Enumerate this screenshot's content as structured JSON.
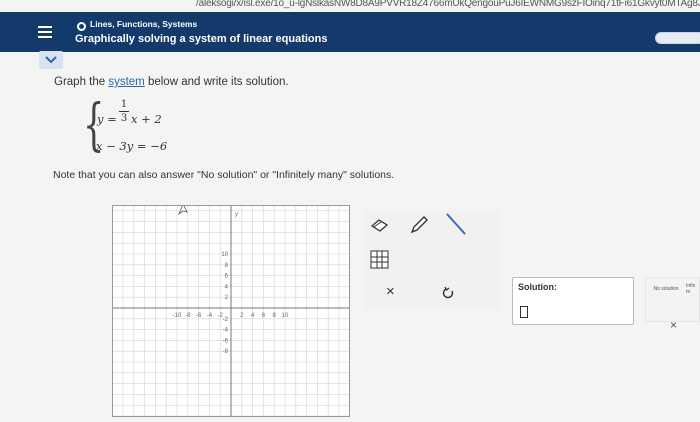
{
  "browser": {
    "url_fragment": "/aleksogi/x/isl.exe/1o_u-lgNslkasNW8D8A9PVVR18Z4766mUkQengouPuJ6IEWNMG9szFIOinq71tFi61Gkvyt0MTAg8JGUQ5c"
  },
  "header": {
    "breadcrumb": "Lines, Functions, Systems",
    "title": "Graphically solving a system of linear equations"
  },
  "question": {
    "prompt_before_link": "Graph the ",
    "prompt_link": "system",
    "prompt_after_link": " below and write its solution.",
    "eq1_lhs": "y = ",
    "eq1_numerator": "1",
    "eq1_denominator": "3",
    "eq1_rhs": "x + 2",
    "eq2": "x − 3y = −6",
    "note": "Note that you can also answer \"No solution\" or \"Infinitely many\" solutions."
  },
  "graph": {
    "x_ticks": [
      "-10",
      "-8",
      "-6",
      "-4",
      "-2",
      "2",
      "4",
      "6",
      "8",
      "10"
    ],
    "y_ticks": [
      "10",
      "8",
      "6",
      "4",
      "2",
      "-2",
      "-4",
      "-6",
      "-8"
    ],
    "xmin": -10,
    "xmax": 10,
    "ymin": -10,
    "ymax": 10,
    "grid": true
  },
  "tools": {
    "eraser": "eraser-icon",
    "pencil": "pencil-icon",
    "line": "line-tool-icon",
    "table": "table-icon",
    "clear": "×",
    "undo": "undo-icon"
  },
  "answer": {
    "solution_label": "Solution:",
    "no_solution_label": "No solution",
    "infinitely_many_label": "Infin m",
    "clear_x": "×"
  },
  "colors": {
    "header_bg": "#143a6b",
    "link": "#2a67b1",
    "grid": "#d3d3d3",
    "axis": "#777777"
  }
}
